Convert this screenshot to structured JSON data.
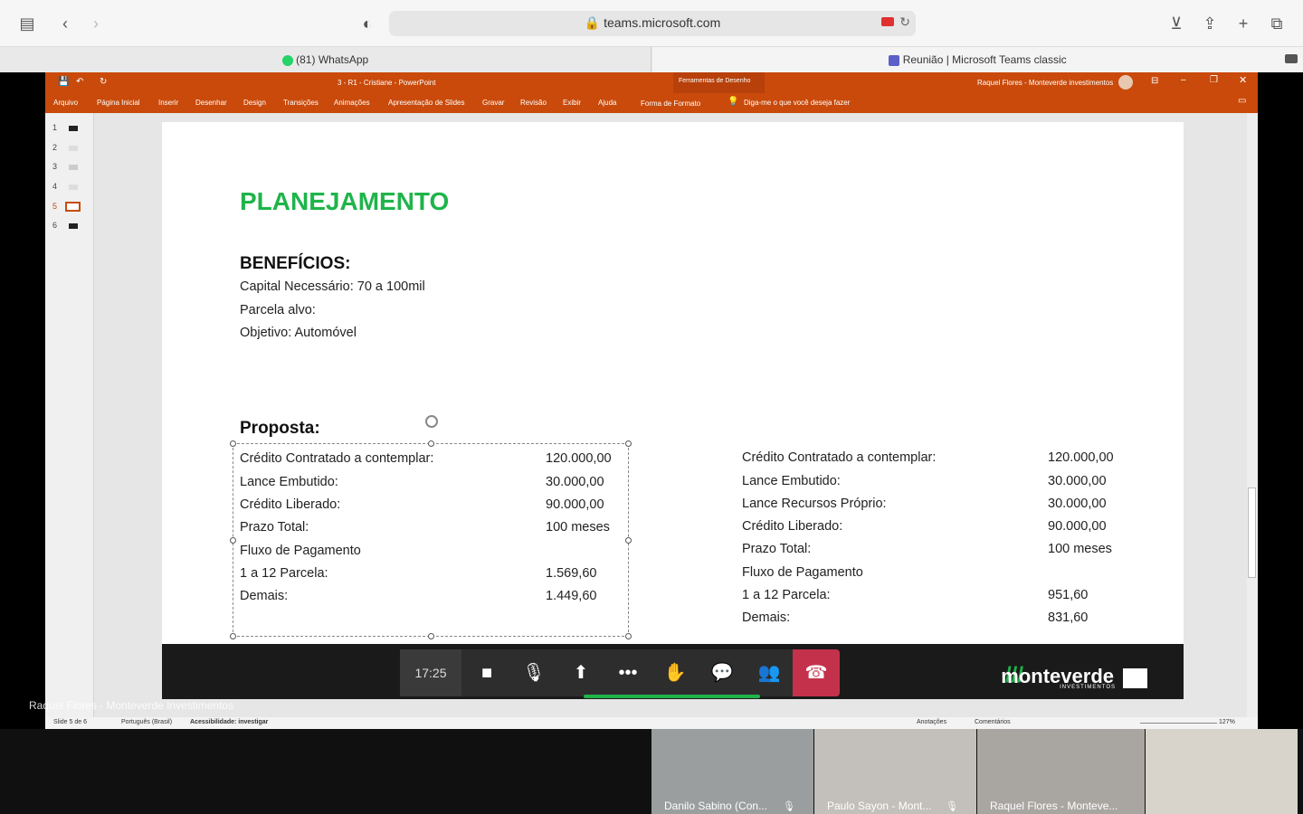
{
  "browser": {
    "url": "teams.microsoft.com",
    "tabs": [
      {
        "label": "(81) WhatsApp"
      },
      {
        "label": "Reunião | Microsoft Teams classic"
      }
    ]
  },
  "ppt": {
    "doc_title": "3 - R1 - Cristiane  -  PowerPoint",
    "drawing_tools": "Ferramentas de Desenho",
    "user": "Raquel Flores - Monteverde investimentos",
    "ribbon": [
      "Arquivo",
      "Página Inicial",
      "Inserir",
      "Desenhar",
      "Design",
      "Transições",
      "Animações",
      "Apresentação de Slides",
      "Gravar",
      "Revisão",
      "Exibir",
      "Ajuda"
    ],
    "format_tab": "Forma de Formato",
    "tell_me": "Diga-me o que você deseja fazer",
    "thumbs": [
      "1",
      "2",
      "3",
      "4",
      "5",
      "6"
    ],
    "status": {
      "slide": "Slide 5 de 6",
      "language": "Português (Brasil)",
      "accessibility": "Acessibilidade: investigar",
      "notes": "Anotações",
      "comments": "Comentários",
      "zoom": "127%"
    }
  },
  "slide": {
    "title": "PLANEJAMENTO",
    "benefits_heading": "BENEFÍCIOS:",
    "benefits": [
      "Capital Necessário: 70 a 100mil",
      "Parcela alvo:",
      "Objetivo: Automóvel"
    ],
    "proposal_heading": "Proposta:",
    "left_labels": [
      "Crédito Contratado a contemplar:",
      "Lance Embutido:",
      "Crédito Liberado:",
      "Prazo Total:",
      "Fluxo de Pagamento",
      "1 a 12 Parcela:",
      "Demais:"
    ],
    "left_values": [
      "120.000,00",
      "30.000,00",
      "90.000,00",
      "100 meses",
      "",
      "1.569,60",
      "1.449,60"
    ],
    "right_labels": [
      "Crédito Contratado a contemplar:",
      "Lance Embutido:",
      "Lance Recursos Próprio:",
      "Crédito Liberado:",
      "Prazo Total:",
      "Fluxo de Pagamento",
      "1 a 12 Parcela:",
      "Demais:"
    ],
    "right_values": [
      "120.000,00",
      "30.000,00",
      "30.000,00",
      "90.000,00",
      "100 meses",
      "",
      "951,60",
      "831,60"
    ],
    "logo": "monteverde",
    "logo_sub": "INVESTIMENTOS"
  },
  "call": {
    "time": "17:25",
    "presenter": "Raquel Flores - Monteverde Investimentos",
    "participants": [
      "Danilo Sabino (Con...",
      "Paulo Sayon - Mont...",
      "Raquel Flores - Monteve..."
    ]
  },
  "colors": {
    "ppt_orange": "#c94a0b",
    "title_green": "#1fb44a",
    "hangup_red": "#c4314b"
  }
}
